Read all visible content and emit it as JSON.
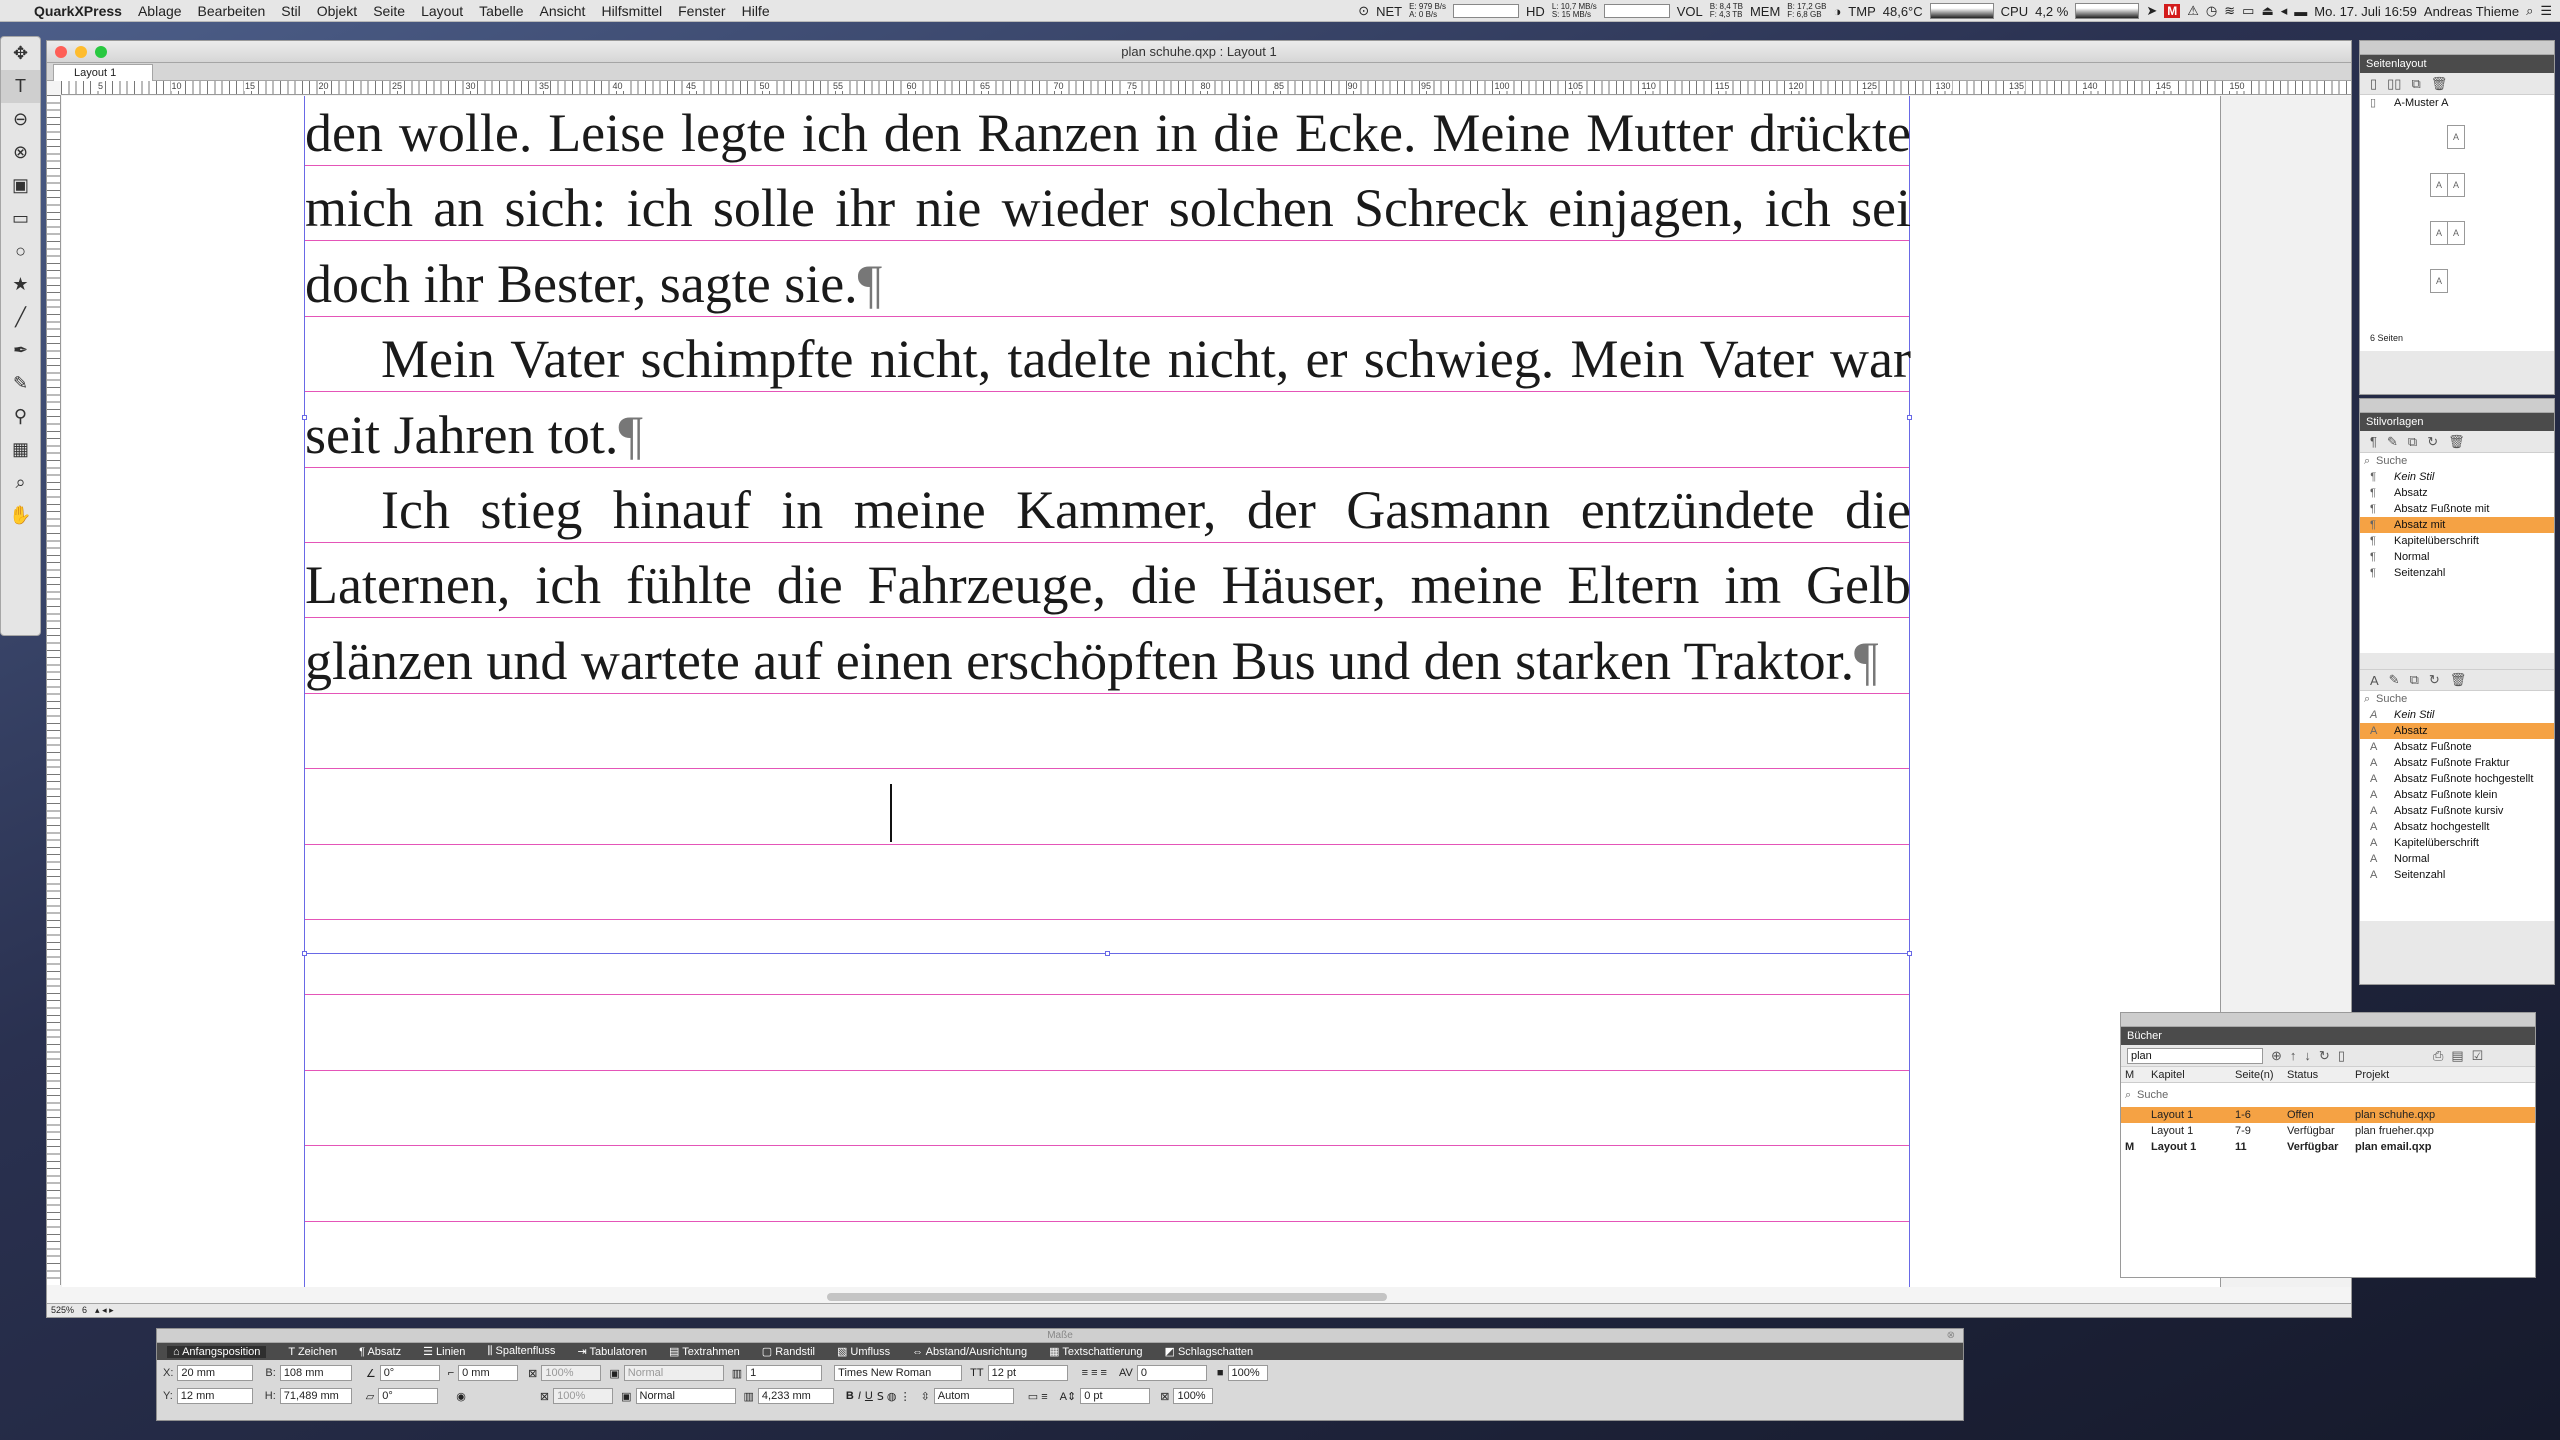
{
  "menubar": {
    "app": "QuarkXPress",
    "items": [
      "Ablage",
      "Bearbeiten",
      "Stil",
      "Objekt",
      "Seite",
      "Layout",
      "Tabelle",
      "Ansicht",
      "Hilfsmittel",
      "Fenster",
      "Hilfe"
    ],
    "status": {
      "net": "NET",
      "net_e": "E: 979 B/s",
      "net_a": "A: 0 B/s",
      "hd": "HD",
      "hd_l": "L: 10,7 MB/s",
      "hd_s": "S: 15 MB/s",
      "vol": "VOL",
      "vol_b": "B: 8,4 TB",
      "vol_f": "F: 4,3 TB",
      "mem": "MEM",
      "mem_b": "B: 17,2 GB",
      "mem_f": "F: 6,8 GB",
      "tmp": "TMP",
      "tmp_val": "48,6°C",
      "cpu": "CPU",
      "cpu_val": "4,2 %",
      "m_badge": "M",
      "datetime": "Mo. 17. Juli 16:59",
      "user": "Andreas Thieme"
    }
  },
  "document": {
    "title": "plan schuhe.qxp : Layout 1",
    "tab": "Layout 1",
    "ruler_numbers": [
      "5",
      "10",
      "15",
      "20",
      "25",
      "30",
      "35",
      "40",
      "45",
      "50",
      "55",
      "60",
      "65",
      "70",
      "75",
      "80",
      "85",
      "90",
      "95",
      "100",
      "105",
      "110",
      "115",
      "120",
      "125",
      "130",
      "135",
      "140",
      "145",
      "150"
    ],
    "paragraphs": [
      {
        "text": "den wolle. Leise legte ich den Ranzen in die Ecke. Meine Mutter drückte mich an sich: ich solle ihr nie wieder solchen Schreck einjagen, ich sei doch ihr Bester, sagte sie.",
        "indent": false
      },
      {
        "text": "Mein Vater schimpfte nicht, tadelte nicht, er schwieg. Mein Vater war seit Jahren tot.",
        "indent": true
      },
      {
        "text": "Ich stieg hinauf in meine Kammer, der Gasmann entzündete die Laternen, ich fühlte die Fahrzeuge, die Häuser, meine Eltern im Gelb glänzen und wartete auf einen erschöpften Bus und den starken Traktor.",
        "indent": true
      }
    ],
    "zoom": "525%",
    "page": "6"
  },
  "seitenlayout": {
    "title": "Seitenlayout",
    "master": "A-Muster A",
    "page_count": "6 Seiten",
    "thumb_label": "A"
  },
  "stilvorlagen": {
    "title": "Stilvorlagen",
    "search": "Suche",
    "paragraph_styles": [
      "Kein Stil",
      "Absatz",
      "Absatz Fußnote mit",
      "Absatz mit",
      "Kapitelüberschrift",
      "Normal",
      "Seitenzahl"
    ],
    "char_search": "Suche",
    "character_styles": [
      "Kein Stil",
      "Absatz",
      "Absatz Fußnote",
      "Absatz Fußnote Fraktur",
      "Absatz Fußnote hochgestellt",
      "Absatz Fußnote klein",
      "Absatz Fußnote kursiv",
      "Absatz hochgestellt",
      "Kapitelüberschrift",
      "Normal",
      "Seitenzahl"
    ]
  },
  "buecher": {
    "title": "Bücher",
    "book_name": "plan",
    "columns": [
      "M",
      "Kapitel",
      "Seite(n)",
      "Status",
      "Projekt"
    ],
    "search": "Suche",
    "rows": [
      {
        "m": "",
        "kapitel": "Layout 1",
        "seiten": "1-6",
        "status": "Offen",
        "projekt": "plan schuhe.qxp"
      },
      {
        "m": "",
        "kapitel": "Layout 1",
        "seiten": "7-9",
        "status": "Verfügbar",
        "projekt": "plan frueher.qxp"
      },
      {
        "m": "M",
        "kapitel": "Layout 1",
        "seiten": "11",
        "status": "Verfügbar",
        "projekt": "plan email.qxp"
      }
    ]
  },
  "measurements": {
    "title": "Maße",
    "tabs": [
      "Anfangsposition",
      "Zeichen",
      "Absatz",
      "Linien",
      "Spaltenfluss",
      "Tabulatoren",
      "Textrahmen",
      "Randstil",
      "Umfluss",
      "Abstand/Ausrichtung",
      "Textschattierung",
      "Schlagschatten"
    ],
    "x_label": "X:",
    "x": "20 mm",
    "y_label": "Y:",
    "y": "12 mm",
    "w_label": "B:",
    "w": "108 mm",
    "h_label": "H:",
    "h": "71,489 mm",
    "angle1": "0°",
    "angle2": "0°",
    "corner": "0 mm",
    "opacity1": "100%",
    "opacity2": "100%",
    "blend1": "Normal",
    "blend2": "Normal",
    "cols": "1",
    "gutter": "4,233 mm",
    "font": "Times New Roman",
    "size": "12 pt",
    "leading": "Autom",
    "kern": "0",
    "track": "0 pt",
    "scale1": "100%",
    "scale2": "100%"
  }
}
